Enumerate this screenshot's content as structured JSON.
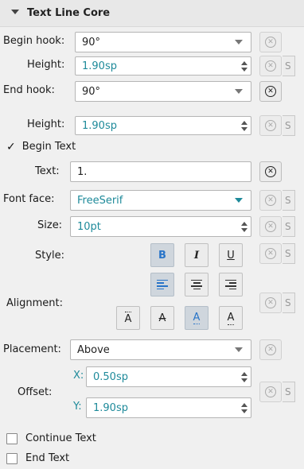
{
  "section": {
    "title": "Text Line Core"
  },
  "begin_hook": {
    "label": "Begin hook:",
    "value": "90°"
  },
  "begin_height": {
    "label": "Height:",
    "value": "1.90sp"
  },
  "end_hook": {
    "label": "End hook:",
    "value": "90°"
  },
  "end_height": {
    "label": "Height:",
    "value": "1.90sp"
  },
  "begin_text": {
    "label": "Begin Text",
    "checked": true
  },
  "text": {
    "label": "Text:",
    "value": "1."
  },
  "font_face": {
    "label": "Font face:",
    "value": "FreeSerif"
  },
  "size": {
    "label": "Size:",
    "value": "10pt"
  },
  "style": {
    "label": "Style:",
    "bold": "B",
    "italic": "I",
    "underline": "U"
  },
  "alignment": {
    "label": "Alignment:",
    "vpos": [
      "A",
      "A",
      "A",
      "A"
    ]
  },
  "placement": {
    "label": "Placement:",
    "value": "Above"
  },
  "offset": {
    "label": "Offset:",
    "x_label": "X:",
    "x_value": "0.50sp",
    "y_label": "Y:",
    "y_value": "1.90sp"
  },
  "continue_text": {
    "label": "Continue Text",
    "checked": false
  },
  "end_text": {
    "label": "End Text",
    "checked": false
  },
  "style_btn": {
    "s_label": "S"
  },
  "colors": {
    "accent": "#1e8a9a",
    "bold_blue": "#2874c8",
    "toggled": "#cfd6dd"
  }
}
